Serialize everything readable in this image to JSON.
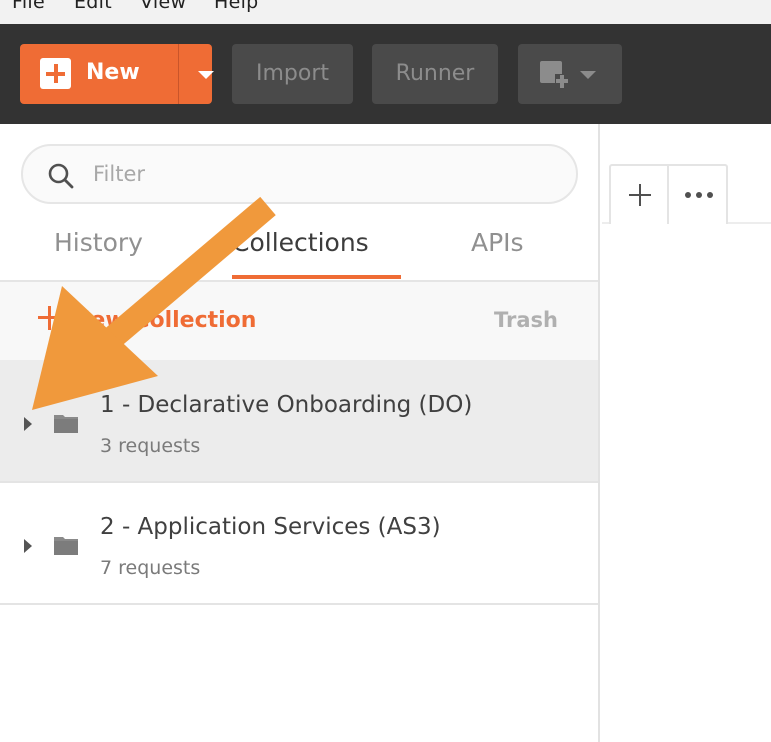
{
  "menu": {
    "items": [
      "File",
      "Edit",
      "View",
      "Help"
    ]
  },
  "toolbar": {
    "new_label": "New",
    "import_label": "Import",
    "runner_label": "Runner"
  },
  "sidebar": {
    "search": {
      "placeholder": "Filter",
      "value": ""
    },
    "tabs": [
      {
        "label": "History"
      },
      {
        "label": "Collections",
        "active": true
      },
      {
        "label": "APIs"
      }
    ],
    "new_collection_label": "New Collection",
    "trash_label": "Trash",
    "collections": [
      {
        "name": "1 - Declarative Onboarding (DO)",
        "count": "3 requests",
        "selected": true
      },
      {
        "name": "2 - Application Services (AS3)",
        "count": "7 requests",
        "selected": false
      }
    ]
  },
  "colors": {
    "accent": "#ef6c35",
    "toolbar_bg": "#333333",
    "annotation_arrow": "#f0993c"
  }
}
